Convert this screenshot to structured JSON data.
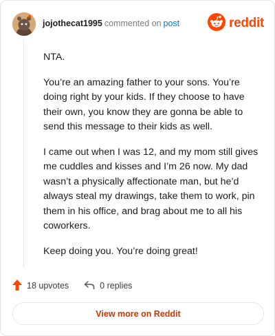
{
  "header": {
    "username": "jojothecat1995",
    "action_text": "commented on",
    "post_link": "post",
    "brand_name": "reddit"
  },
  "comment": {
    "paragraphs": [
      "NTA.",
      "You’re an amazing father to your sons. You’re doing right by your kids. If they choose to have their own, you know they are gonna be able to send this message to their kids as well.",
      "I came out when I was 12, and my mom still gives me cuddles and kisses and I’m 26 now. My dad wasn’t a physically affectionate man, but he’d always steal my drawings, take them to work, pin them in his office, and brag about me to all his coworkers.",
      "Keep doing you. You’re doing great!"
    ]
  },
  "actions": {
    "upvotes_label": "18 upvotes",
    "replies_label": "0 replies"
  },
  "footer": {
    "view_more_label": "View more on Reddit"
  },
  "colors": {
    "brand_orange": "#ff4500",
    "link_blue": "#0079d3",
    "cta_text": "#cc3600"
  },
  "icons": {
    "avatar": "avatar-icon",
    "brand": "reddit-logo-icon",
    "upvote": "upvote-arrow-icon",
    "reply": "reply-arrow-icon"
  }
}
